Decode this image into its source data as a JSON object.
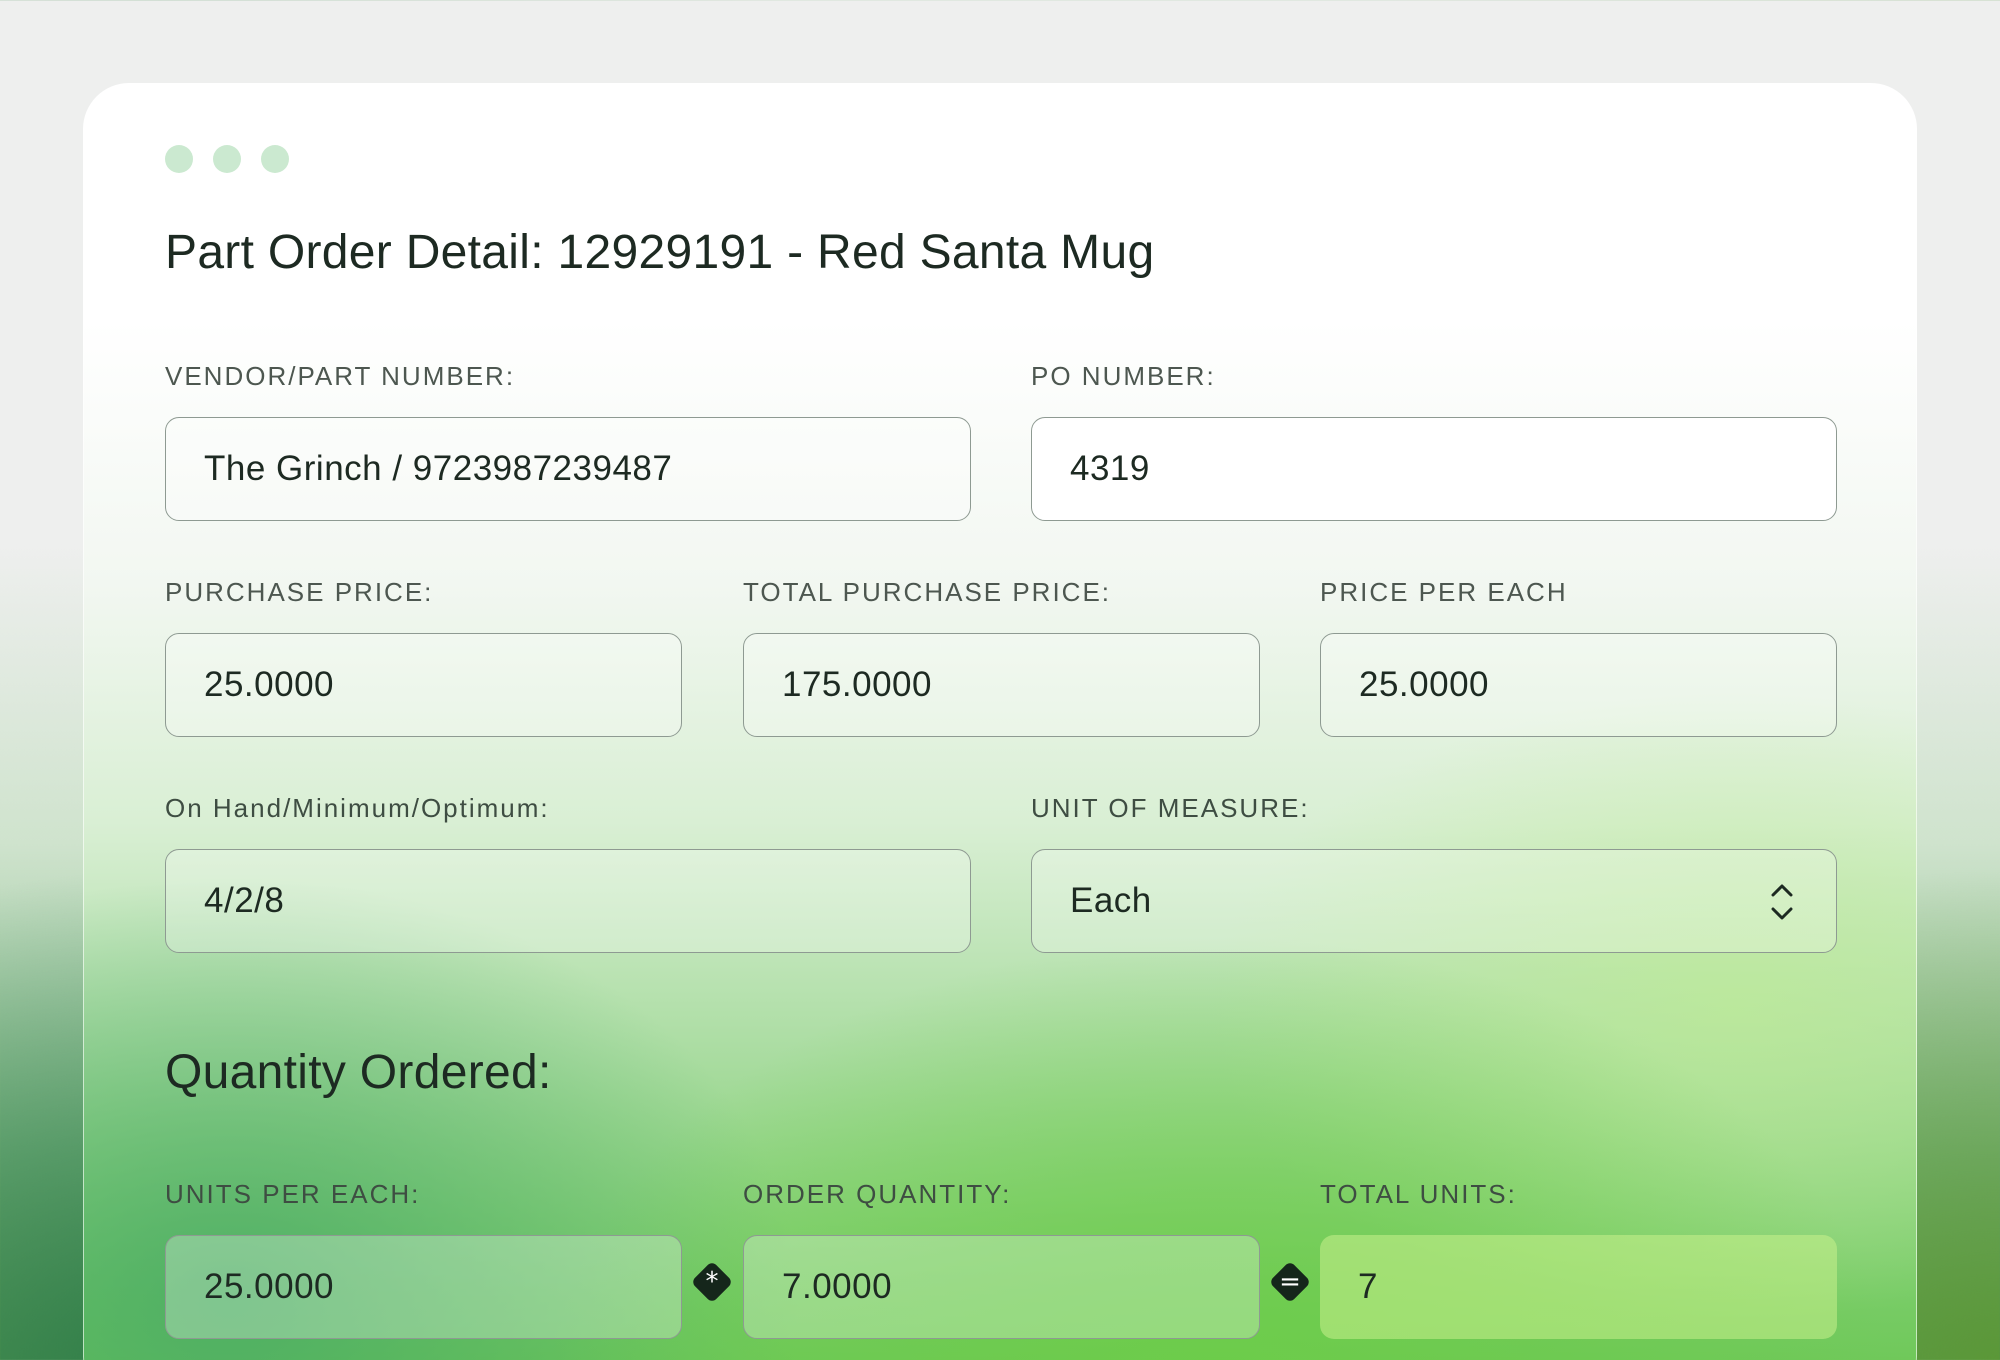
{
  "window": {
    "title": "Part Order Detail: 12929191 - Red Santa Mug"
  },
  "fields": {
    "vendor_part": {
      "label": "VENDOR/PART NUMBER:",
      "value": "The Grinch / 9723987239487"
    },
    "po_number": {
      "label": "PO NUMBER:",
      "value": "4319"
    },
    "purchase_price": {
      "label": "PURCHASE PRICE:",
      "value": "25.0000"
    },
    "total_purchase_price": {
      "label": "TOTAL PURCHASE PRICE:",
      "value": "175.0000"
    },
    "price_per_each": {
      "label": "PRICE PER EACH",
      "value": "25.0000"
    },
    "on_hand": {
      "label": "On Hand/Minimum/Optimum:",
      "value": "4/2/8"
    },
    "unit_of_measure": {
      "label": "UNIT OF MEASURE:",
      "value": "Each"
    }
  },
  "quantity": {
    "title": "Quantity Ordered:",
    "units_per_each": {
      "label": "UNITS PER EACH:",
      "value": "25.0000"
    },
    "multiply_symbol": "*",
    "order_quantity": {
      "label": "ORDER QUANTITY:",
      "value": "7.0000"
    },
    "equals_symbol": "=",
    "total_units": {
      "label": "TOTAL UNITS:",
      "value": "7"
    }
  },
  "colors": {
    "dot": "#cbe9d0",
    "operator_badge": "#15261b",
    "text": "#1d2a22",
    "label": "#4d5750"
  },
  "icons": {
    "window_dots": "three-dots-icon",
    "select_toggle": "chevron-up-down-icon"
  }
}
